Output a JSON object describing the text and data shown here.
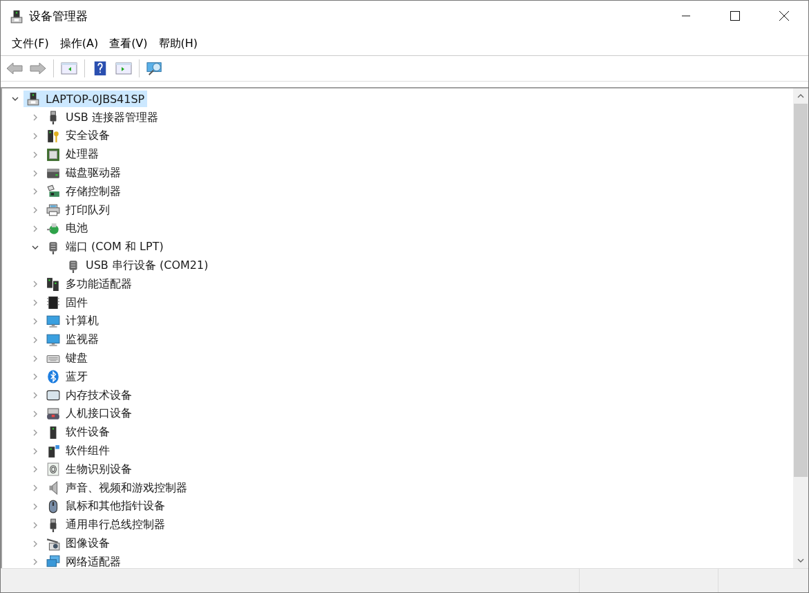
{
  "window": {
    "title": "设备管理器"
  },
  "menu": [
    {
      "label": "文件(F)"
    },
    {
      "label": "操作(A)"
    },
    {
      "label": "查看(V)"
    },
    {
      "label": "帮助(H)"
    }
  ],
  "tree": {
    "label": "LAPTOP-0JBS41SP",
    "kind": "computer-root",
    "expanded": true,
    "selected": true,
    "children": [
      {
        "label": "USB 连接器管理器",
        "kind": "usb",
        "expanded": false,
        "selected": false
      },
      {
        "label": "安全设备",
        "kind": "security",
        "expanded": false,
        "selected": false
      },
      {
        "label": "处理器",
        "kind": "cpu",
        "expanded": false,
        "selected": false
      },
      {
        "label": "磁盘驱动器",
        "kind": "disk",
        "expanded": false,
        "selected": false
      },
      {
        "label": "存储控制器",
        "kind": "storage",
        "expanded": false,
        "selected": false
      },
      {
        "label": "打印队列",
        "kind": "printer",
        "expanded": false,
        "selected": false
      },
      {
        "label": "电池",
        "kind": "battery",
        "expanded": false,
        "selected": false
      },
      {
        "label": "端口 (COM 和 LPT)",
        "kind": "port",
        "expanded": true,
        "selected": false,
        "children": [
          {
            "label": "USB 串行设备 (COM21)",
            "kind": "port",
            "selected": false
          }
        ]
      },
      {
        "label": "多功能适配器",
        "kind": "adapter",
        "expanded": false,
        "selected": false
      },
      {
        "label": "固件",
        "kind": "firmware",
        "expanded": false,
        "selected": false
      },
      {
        "label": "计算机",
        "kind": "monitor",
        "expanded": false,
        "selected": false
      },
      {
        "label": "监视器",
        "kind": "monitor",
        "expanded": false,
        "selected": false
      },
      {
        "label": "键盘",
        "kind": "keyboard",
        "expanded": false,
        "selected": false
      },
      {
        "label": "蓝牙",
        "kind": "bluetooth",
        "expanded": false,
        "selected": false
      },
      {
        "label": "内存技术设备",
        "kind": "memory",
        "expanded": false,
        "selected": false
      },
      {
        "label": "人机接口设备",
        "kind": "hid",
        "expanded": false,
        "selected": false
      },
      {
        "label": "软件设备",
        "kind": "software",
        "expanded": false,
        "selected": false
      },
      {
        "label": "软件组件",
        "kind": "component",
        "expanded": false,
        "selected": false
      },
      {
        "label": "生物识别设备",
        "kind": "biometric",
        "expanded": false,
        "selected": false
      },
      {
        "label": "声音、视频和游戏控制器",
        "kind": "sound",
        "expanded": false,
        "selected": false
      },
      {
        "label": "鼠标和其他指针设备",
        "kind": "mouse",
        "expanded": false,
        "selected": false
      },
      {
        "label": "通用串行总线控制器",
        "kind": "usb",
        "expanded": false,
        "selected": false
      },
      {
        "label": "图像设备",
        "kind": "camera",
        "expanded": false,
        "selected": false
      },
      {
        "label": "网络适配器",
        "kind": "network",
        "expanded": false,
        "selected": false
      }
    ]
  }
}
